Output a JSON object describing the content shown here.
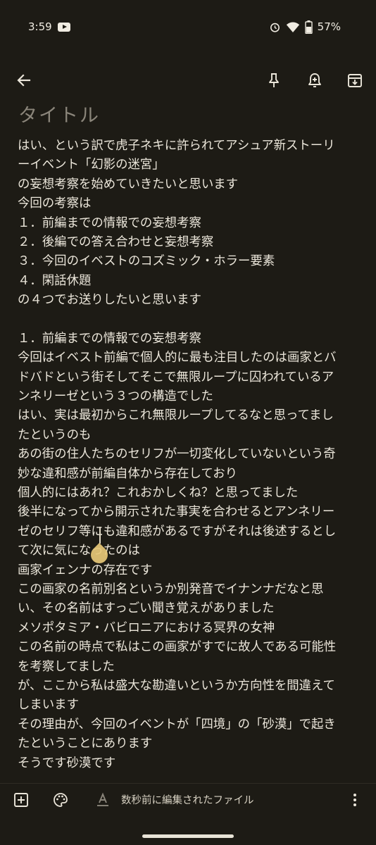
{
  "status_bar": {
    "time": "3:59",
    "battery_percent": "57%",
    "icons": [
      "youtube-icon",
      "alarm-icon",
      "wifi-icon",
      "battery-icon"
    ]
  },
  "toolbar": {
    "icons": [
      "back-arrow-icon",
      "pin-icon",
      "add-reminder-icon",
      "archive-icon"
    ]
  },
  "note": {
    "title": "タイトル",
    "lines": [
      "はい、という訳で虎子ネキに許られてアシュア新ストーリ",
      "ーイベント「幻影の迷宮」",
      "の妄想考察を始めていきたいと思います",
      "今回の考察は",
      "１．前編までの情報での妄想考察",
      "２．後編での答え合わせと妄想考察",
      "３．今回のイベストのコズミック・ホラー要素",
      "４．閑話休題",
      "の４つでお送りしたいと思います",
      "",
      "１．前編までの情報での妄想考察",
      "今回はイベスト前編で個人的に最も注目したのは画家とバ",
      "ドバドという街そしてそこで無限ループに囚われているア",
      "ンネリーゼという３つの構造でした",
      "はい、実は最初からこれ無限ループしてるなと思ってまし",
      "たというのも",
      "あの街の住人たちのセリフが一切変化していないという奇",
      "妙な違和感が前編自体から存在しており",
      "個人的にはあれ？これおかしくね？と思ってました",
      "後半になってから開示された事実を合わせるとアンネリー",
      "ゼのセリフ等にも違和感があるですがそれは後述するとし",
      "て次に気になったのは",
      "画家イェンナの存在です",
      "この画家の名前別名というか別発音でイナンナだなと思",
      "い、その名前はすっごい聞き覚えがありました",
      "メソポタミア・バビロニアにおける冥界の女神",
      "この名前の時点で私はこの画家がすでに故人である可能性",
      "を考察してました",
      "が、ここから私は盛大な勘違いというか方向性を間違えて",
      "しまいます",
      "その理由が、今回のイベントが「四境」の「砂漠」で起き",
      "たということにあります",
      "そうです砂漠です"
    ]
  },
  "bottom_bar": {
    "edited_text": "数秒前に編集されたファイル",
    "icons": [
      "add-box-icon",
      "palette-icon",
      "text-format-icon",
      "more-vert-icon"
    ]
  },
  "colors": {
    "background": "#1d1b15",
    "text": "#ebe6da",
    "title_hint": "#8a857a",
    "caret_handle": "#e7c878"
  }
}
